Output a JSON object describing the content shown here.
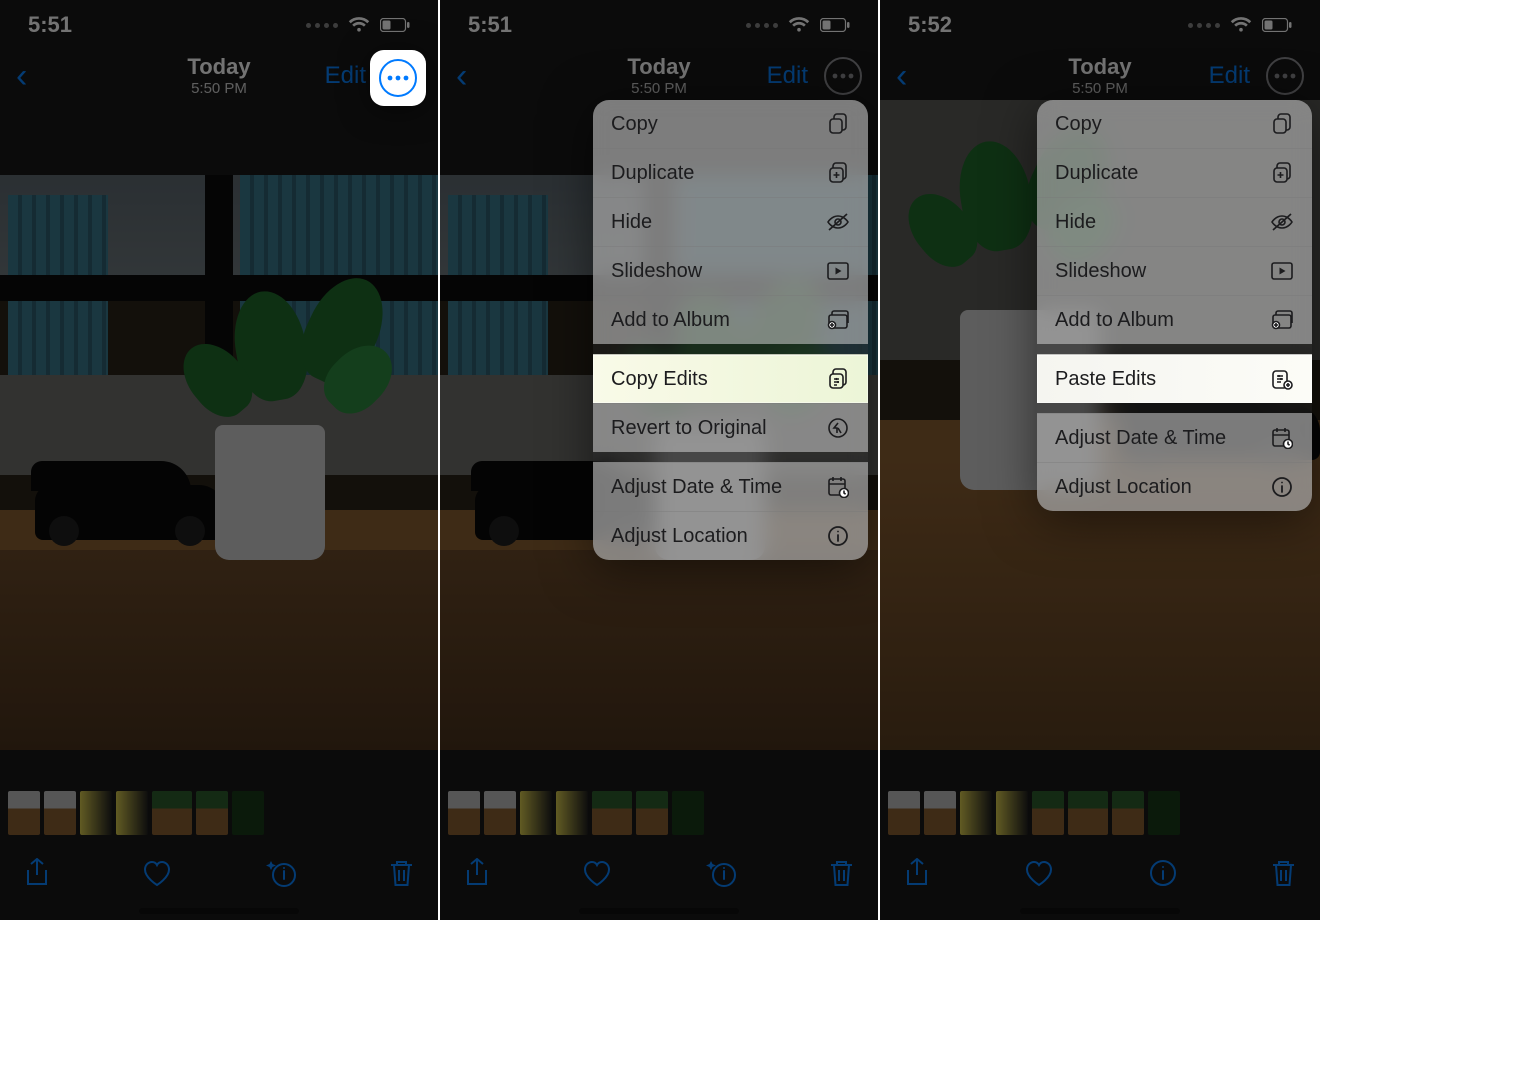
{
  "status_time_a": "5:51",
  "status_time_b": "5:52",
  "header": {
    "title": "Today",
    "subtitle": "5:50 PM",
    "edit": "Edit"
  },
  "menu": {
    "copy": "Copy",
    "duplicate": "Duplicate",
    "hide": "Hide",
    "slideshow": "Slideshow",
    "add_album": "Add to Album",
    "copy_edits": "Copy Edits",
    "paste_edits": "Paste Edits",
    "revert": "Revert to Original",
    "adj_date": "Adjust Date & Time",
    "adj_loc": "Adjust Location"
  }
}
